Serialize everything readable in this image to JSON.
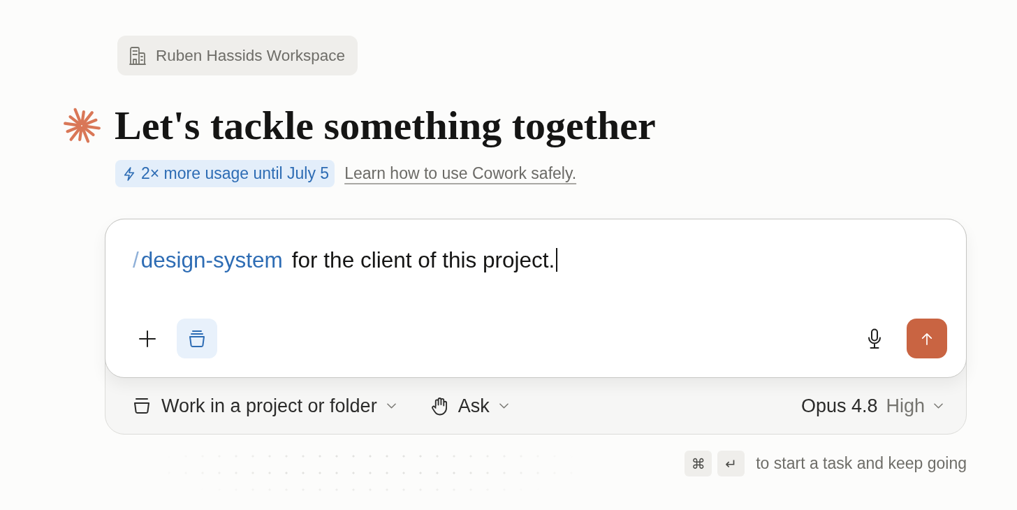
{
  "workspace": {
    "label": "Ruben Hassids Workspace"
  },
  "heading": {
    "title": "Let's tackle something together"
  },
  "promo": {
    "badge": "2× more usage until July 5",
    "link": "Learn how to use Cowork safely."
  },
  "composer": {
    "trigger": "/",
    "command": "design-system",
    "value": "for the client of this project.",
    "focused": true,
    "tools": [
      {
        "kind": "add",
        "active": false
      },
      {
        "kind": "project",
        "active": true
      }
    ],
    "actions": [
      {
        "kind": "voice"
      },
      {
        "kind": "send"
      }
    ]
  },
  "options": [
    {
      "kind": "folder",
      "label": "Work in a project or folder"
    },
    {
      "kind": "mode",
      "label": "Ask"
    }
  ],
  "model": {
    "name": "Opus 4.8",
    "effort": "High"
  },
  "shortcut": {
    "keys": [
      "⌘",
      "↵"
    ],
    "hint": "to start a task and keep going"
  }
}
